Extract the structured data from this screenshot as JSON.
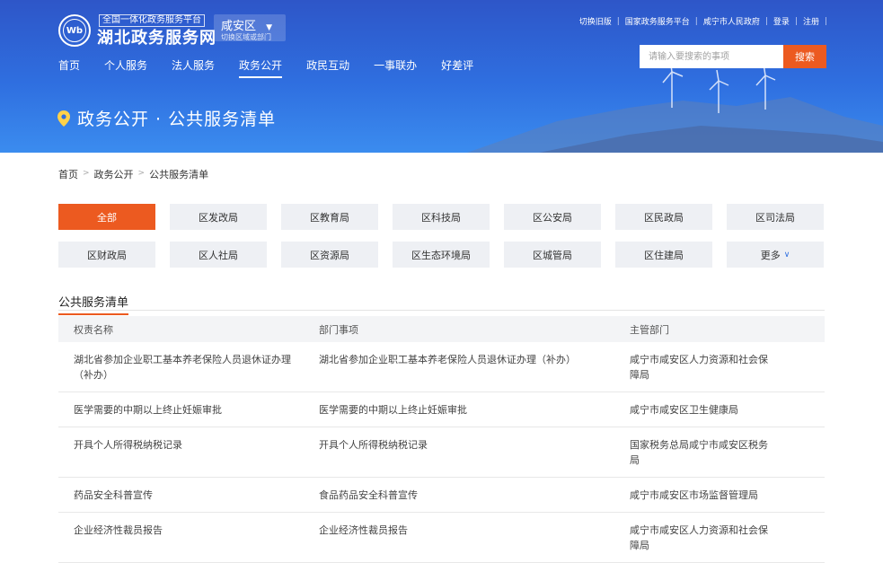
{
  "header": {
    "logo_text": "Wb",
    "platform_tag": "全国一体化政务服务平台",
    "site_name": "湖北政务服务网",
    "region": {
      "name": "咸安区",
      "sub": "切换区域或部门"
    },
    "top_links": [
      "切换旧版",
      "国家政务服务平台",
      "咸宁市人民政府",
      "登录",
      "注册"
    ],
    "search": {
      "placeholder": "请输入要搜索的事项",
      "button_label": "搜索"
    },
    "nav": [
      "首页",
      "个人服务",
      "法人服务",
      "政务公开",
      "政民互动",
      "一事联办",
      "好差评"
    ],
    "nav_active_index": 3,
    "page_title": "政务公开 · 公共服务清单"
  },
  "breadcrumb": [
    "首页",
    "政务公开",
    "公共服务清单"
  ],
  "filters": {
    "items": [
      "全部",
      "区发改局",
      "区教育局",
      "区科技局",
      "区公安局",
      "区民政局",
      "区司法局",
      "区财政局",
      "区人社局",
      "区资源局",
      "区生态环境局",
      "区城管局",
      "区住建局",
      "更多"
    ],
    "active_index": 0
  },
  "list": {
    "title": "公共服务清单",
    "columns": [
      "权责名称",
      "部门事项",
      "主管部门"
    ],
    "rows": [
      [
        "湖北省参加企业职工基本养老保险人员退休证办理（补办）",
        "湖北省参加企业职工基本养老保险人员退休证办理（补办）",
        "咸宁市咸安区人力资源和社会保障局"
      ],
      [
        "医学需要的中期以上终止妊娠审批",
        "医学需要的中期以上终止妊娠审批",
        "咸宁市咸安区卫生健康局"
      ],
      [
        "开具个人所得税纳税记录",
        "开具个人所得税纳税记录",
        "国家税务总局咸宁市咸安区税务局"
      ],
      [
        "药品安全科普宣传",
        "食品药品安全科普宣传",
        "咸宁市咸安区市场监督管理局"
      ],
      [
        "企业经济性裁员报告",
        "企业经济性裁员报告",
        "咸宁市咸安区人力资源和社会保障局"
      ]
    ]
  },
  "colors": {
    "primary_blue": "#2f6fe0",
    "accent_orange": "#ec5a20",
    "chip_bg": "#eef0f4"
  }
}
